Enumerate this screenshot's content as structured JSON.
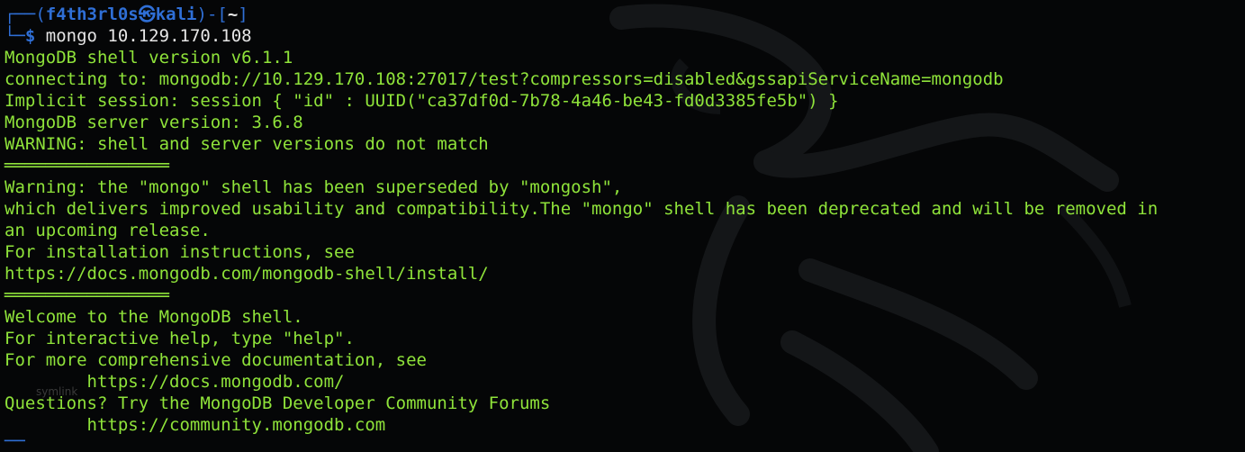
{
  "prompt": {
    "frame_top_left": "┌──(",
    "user": "f4th3rl0s",
    "at_symbol": "㉿",
    "host": "kali",
    "frame_mid": ")-[",
    "dir": "~",
    "frame_end": "]",
    "frame_bottom_left": "└─",
    "dollar": "$",
    "command": "mongo 10.129.170.108"
  },
  "output": [
    "MongoDB shell version v6.1.1",
    "connecting to: mongodb://10.129.170.108:27017/test?compressors=disabled&gssapiServiceName=mongodb",
    "Implicit session: session { \"id\" : UUID(\"ca37df0d-7b78-4a46-be43-fd0d3385fe5b\") }",
    "MongoDB server version: 3.6.8",
    "WARNING: shell and server versions do not match",
    "════════════════",
    "Warning: the \"mongo\" shell has been superseded by \"mongosh\",",
    "which delivers improved usability and compatibility.The \"mongo\" shell has been deprecated and will be removed in",
    "an upcoming release.",
    "For installation instructions, see",
    "https://docs.mongodb.com/mongodb-shell/install/",
    "════════════════",
    "Welcome to the MongoDB shell.",
    "For interactive help, type \"help\".",
    "For more comprehensive documentation, see",
    "        https://docs.mongodb.com/",
    "Questions? Try the MongoDB Developer Community Forums",
    "        https://community.mongodb.com"
  ],
  "ghost_label": "symlink",
  "next_prompt_fragment": "──",
  "colors": {
    "background": "#050607",
    "output_text": "#8fe33a",
    "prompt_blue": "#2f6fd6",
    "command_text": "#e6e6e6"
  }
}
